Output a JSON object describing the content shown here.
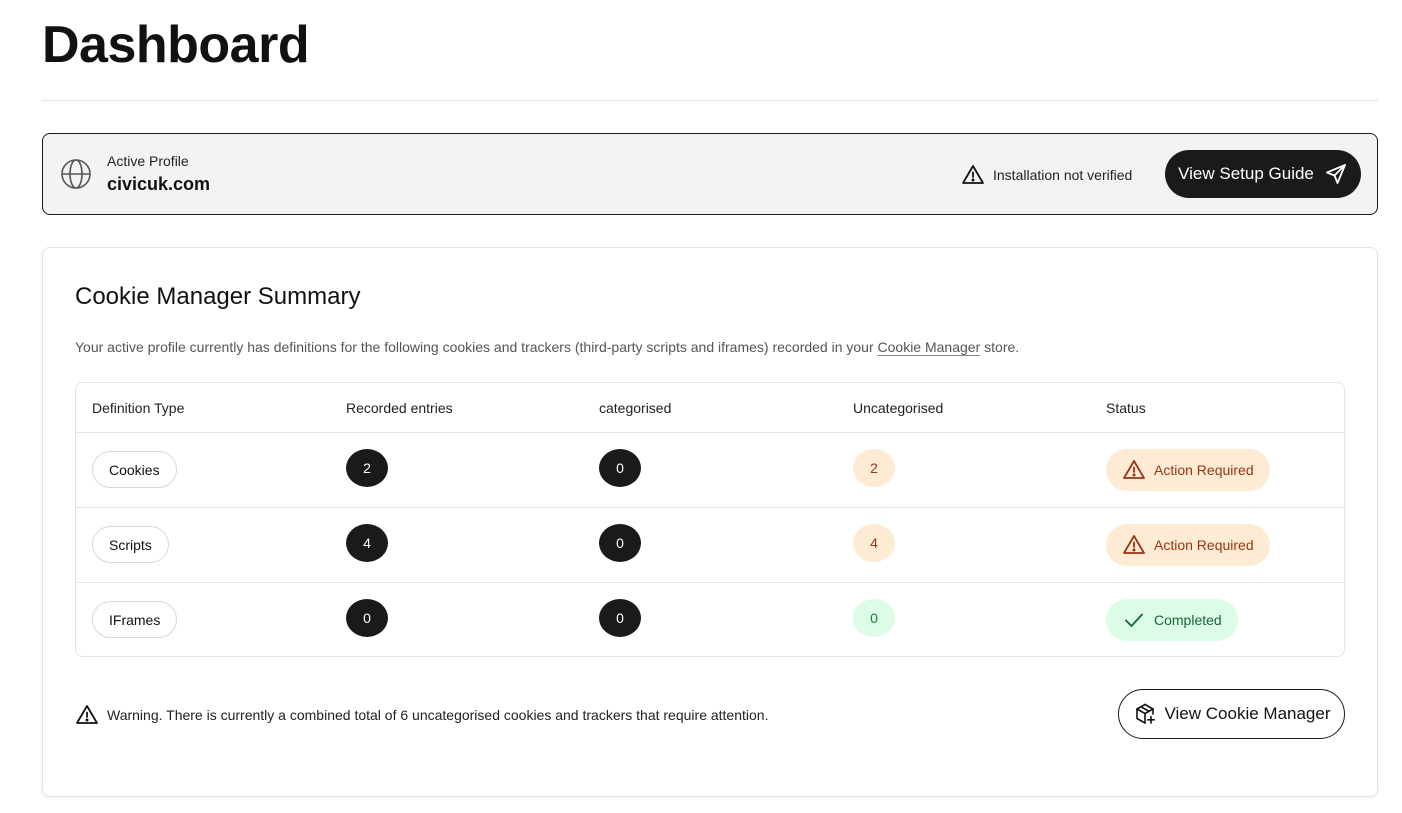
{
  "page": {
    "title": "Dashboard"
  },
  "profile": {
    "label": "Active Profile",
    "domain": "civicuk.com",
    "install_status": "Installation not verified",
    "setup_button": "View Setup Guide"
  },
  "summary": {
    "title": "Cookie Manager Summary",
    "desc_before": "Your active profile currently has definitions for the following cookies and trackers (third-party scripts and iframes) recorded in your ",
    "desc_link": "Cookie Manager",
    "desc_after": " store.",
    "columns": [
      "Definition Type",
      "Recorded entries",
      "categorised",
      "Uncategorised",
      "Status"
    ],
    "rows": [
      {
        "type": "Cookies",
        "recorded": "2",
        "categorised": "0",
        "uncategorised": "2",
        "status": "Action Required",
        "state": "warn"
      },
      {
        "type": "Scripts",
        "recorded": "4",
        "categorised": "0",
        "uncategorised": "4",
        "status": "Action Required",
        "state": "warn"
      },
      {
        "type": "IFrames",
        "recorded": "0",
        "categorised": "0",
        "uncategorised": "0",
        "status": "Completed",
        "state": "ok"
      }
    ],
    "warning": "Warning. There is currently a combined total of 6 uncategorised cookies and trackers that require attention.",
    "button": "View Cookie Manager"
  },
  "colors": {
    "dark": "#1a1a1a",
    "warn_bg": "#fdebd3",
    "warn_fg": "#9a3412",
    "ok_bg": "#dcfce7",
    "ok_fg": "#166534"
  },
  "icons": {
    "profile": "globe-icon",
    "install": "warning-triangle-icon",
    "setup": "send-icon",
    "warn_status": "warning-triangle-icon",
    "ok_status": "check-icon",
    "cookie_manager": "package-plus-icon"
  }
}
